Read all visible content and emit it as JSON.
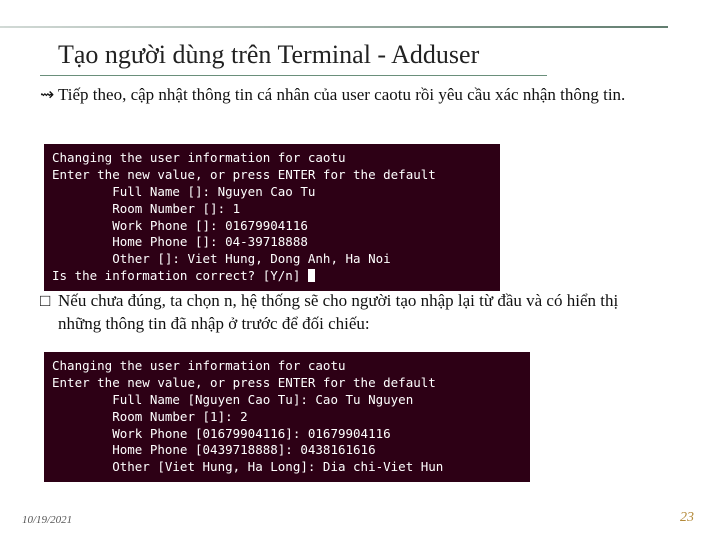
{
  "title": "Tạo người dùng trên Terminal - Adduser",
  "para1_bullet": "⇝",
  "para1": "Tiếp theo, cập nhật thông tin cá nhân của user caotu rồi yêu cầu xác nhận thông tin.",
  "terminal1": {
    "l1": "Changing the user information for caotu",
    "l2": "Enter the new value, or press ENTER for the default",
    "l3": "        Full Name []: Nguyen Cao Tu",
    "l4": "        Room Number []: 1",
    "l5": "        Work Phone []: 01679904116",
    "l6": "        Home Phone []: 04-39718888",
    "l7": "        Other []: Viet Hung, Dong Anh, Ha Noi",
    "l8a": "Is the information correct? [Y/n] "
  },
  "para2_bullet": "□",
  "para2": "Nếu chưa đúng, ta chọn n, hệ thống sẽ cho người tạo nhập lại từ đầu và có hiển thị những thông tin đã nhập ở trước để đối chiếu:",
  "terminal2": {
    "l1": "Changing the user information for caotu",
    "l2": "Enter the new value, or press ENTER for the default",
    "l3": "        Full Name [Nguyen Cao Tu]: Cao Tu Nguyen",
    "l4": "        Room Number [1]: 2",
    "l5": "        Work Phone [01679904116]: 01679904116",
    "l6": "        Home Phone [0439718888]: 0438161616",
    "l7": "        Other [Viet Hung, Ha Long]: Dia chi-Viet Hun"
  },
  "footer": {
    "date": "10/19/2021",
    "page": "23"
  }
}
